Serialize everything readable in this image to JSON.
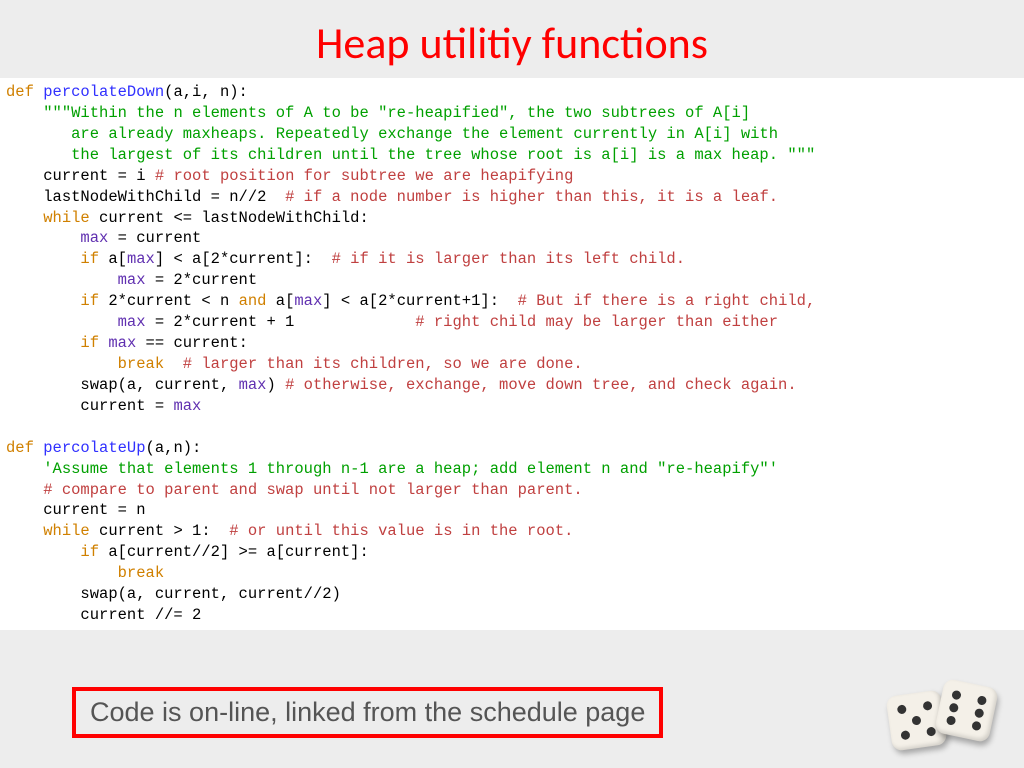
{
  "title": "Heap  utilitiy functions",
  "note": "Code is on-line, linked from the schedule page",
  "code": {
    "pd": {
      "def": "def ",
      "name": "percolateDown",
      "params": "(a,i, n):",
      "doc1": "\"\"\"Within the n elements of A to be \"re-heapified\", the two subtrees of A[i]",
      "doc2": "   are already maxheaps. Repeatedly exchange the element currently in A[i] with",
      "doc3": "   the largest of its children until the tree whose root is a[i] is a max heap. \"\"\"",
      "l1a": "current = i ",
      "l1c": "# root position for subtree we are heapifying",
      "l2a": "lastNodeWithChild = n//2  ",
      "l2c": "# if a node number is higher than this, it is a leaf.",
      "l3a": "while",
      "l3b": " current <= lastNodeWithChild:",
      "l4a": "max",
      "l4b": " = current",
      "l5a": "if",
      "l5b": " a[",
      "l5c": "max",
      "l5d": "] < a[2*current]:  ",
      "l5e": "# if it is larger than its left child.",
      "l6a": "max",
      "l6b": " = 2*current",
      "l7a": "if",
      "l7b": " 2*current < n ",
      "l7c": "and",
      "l7d": " a[",
      "l7e": "max",
      "l7f": "] < a[2*current+1]:  ",
      "l7g": "# But if there is a right child,",
      "l8a": "max",
      "l8b": " = 2*current + 1             ",
      "l8c": "# right child may be larger than either",
      "l9a": "if",
      "l9b": " ",
      "l9c": "max",
      "l9d": " == current:",
      "l10a": "break",
      "l10b": "  ",
      "l10c": "# larger than its children, so we are done.",
      "l11a": "swap(a, current, ",
      "l11b": "max",
      "l11c": ") ",
      "l11d": "# otherwise, exchange, move down tree, and check again.",
      "l12a": "current = ",
      "l12b": "max"
    },
    "pu": {
      "def": "def ",
      "name": "percolateUp",
      "params": "(a,n):",
      "doc": "'Assume that elements 1 through n-1 are a heap; add element n and \"re-heapify\"'",
      "c1": "# compare to parent and swap until not larger than parent.",
      "l1": "current = n",
      "l2a": "while",
      "l2b": " current > 1:  ",
      "l2c": "# or until this value is in the root.",
      "l3a": "if",
      "l3b": " a[current//2] >= a[current]:",
      "l4": "break",
      "l5": "swap(a, current, current//2)",
      "l6": "current //= 2"
    }
  }
}
